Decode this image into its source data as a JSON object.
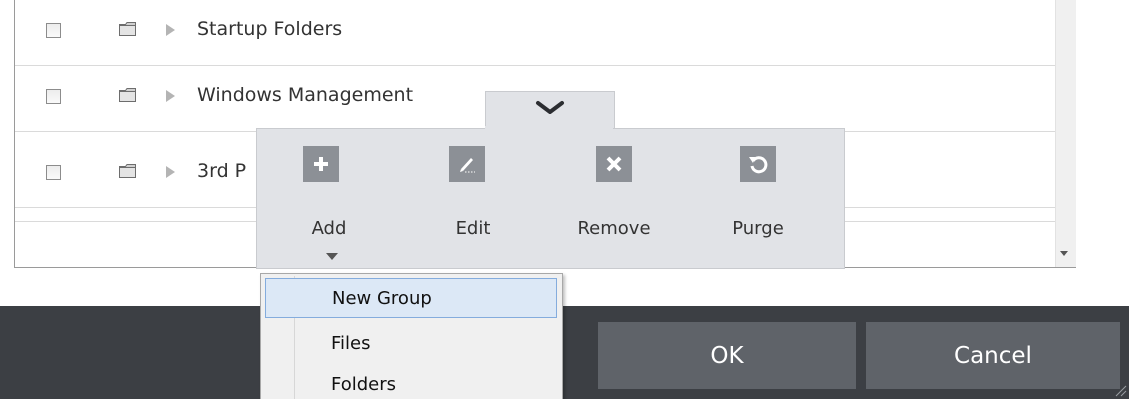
{
  "list": {
    "rows": [
      {
        "label": "Startup Folders"
      },
      {
        "label": "Windows Management"
      },
      {
        "label": "3rd P"
      }
    ]
  },
  "toolbar": {
    "tools": [
      {
        "label": "Add",
        "icon": "plus-icon"
      },
      {
        "label": "Edit",
        "icon": "pencil-icon"
      },
      {
        "label": "Remove",
        "icon": "x-icon"
      },
      {
        "label": "Purge",
        "icon": "refresh-icon"
      }
    ],
    "collapse_icon": "chevron-down-icon"
  },
  "add_menu": {
    "items": [
      {
        "label": "New Group",
        "highlighted": true
      },
      {
        "label": "Files"
      },
      {
        "label": "Folders"
      }
    ]
  },
  "footer": {
    "ok_label": "OK",
    "cancel_label": "Cancel"
  },
  "colors": {
    "footer_bg": "#3c3f44",
    "button_bg": "#5f6369",
    "toolbar_bg": "#e1e3e7",
    "tool_icon_bg": "#8c9096",
    "menu_highlight": "#dce8f6"
  }
}
